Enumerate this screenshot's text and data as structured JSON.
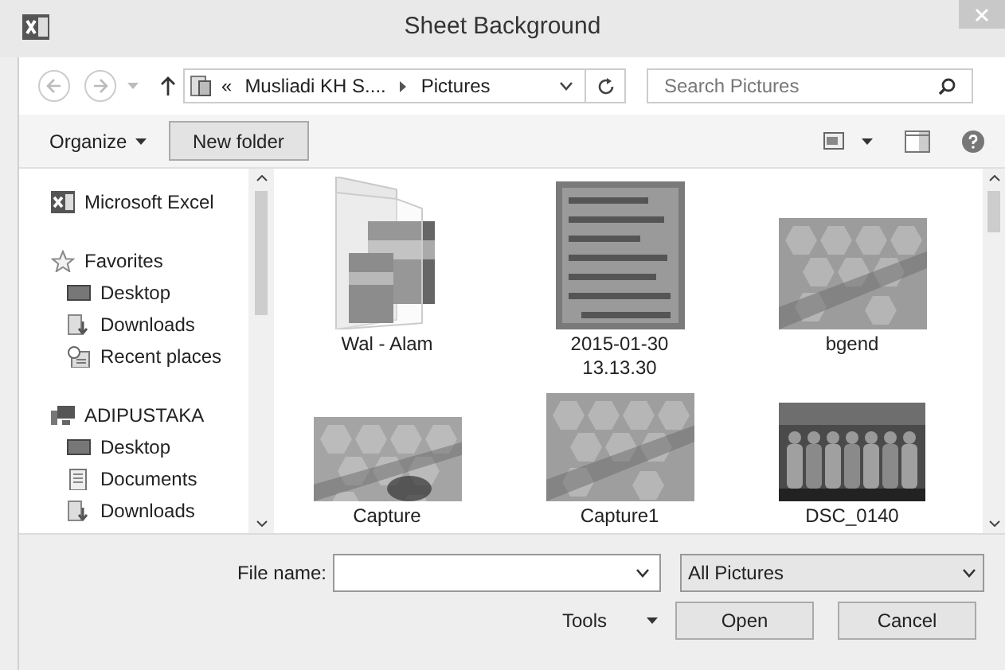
{
  "window": {
    "title": "Sheet Background"
  },
  "address": {
    "overflow_marker": "«",
    "path": [
      "Musliadi KH S....",
      "Pictures"
    ]
  },
  "search": {
    "placeholder": "Search Pictures"
  },
  "toolbar": {
    "organize": "Organize",
    "new_folder": "New folder"
  },
  "sidebar": [
    {
      "label": "Microsoft Excel",
      "kind": "excel"
    },
    {
      "label": "Favorites",
      "kind": "star",
      "children": [
        {
          "label": "Desktop",
          "kind": "desktop"
        },
        {
          "label": "Downloads",
          "kind": "downloads"
        },
        {
          "label": "Recent places",
          "kind": "recent"
        }
      ]
    },
    {
      "label": "ADIPUSTAKA",
      "kind": "computer",
      "children": [
        {
          "label": "Desktop",
          "kind": "desktop"
        },
        {
          "label": "Documents",
          "kind": "documents"
        },
        {
          "label": "Downloads",
          "kind": "downloads"
        }
      ]
    }
  ],
  "files": [
    {
      "name": "Wal - Alam",
      "kind": "folder"
    },
    {
      "name": "2015-01-30 13.13.30",
      "kind": "picture"
    },
    {
      "name": "bgend",
      "kind": "picture"
    },
    {
      "name": "Capture",
      "kind": "picture"
    },
    {
      "name": "Capture1",
      "kind": "picture"
    },
    {
      "name": "DSC_0140",
      "kind": "picture"
    }
  ],
  "footer": {
    "file_name_label": "File name:",
    "filter": "All Pictures",
    "tools": "Tools",
    "buttons": [
      "Open",
      "Cancel"
    ]
  }
}
